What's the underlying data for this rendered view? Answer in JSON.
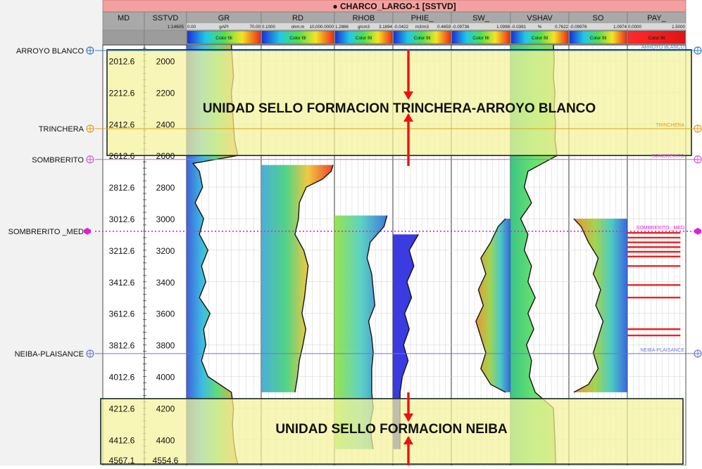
{
  "window": {
    "title": "● CHARCO_LARGO-1 [SSTVD]"
  },
  "colors": {
    "title_bar": "#f4a0a0",
    "header_bg": "#a9a9a9",
    "track_bg": "#ffffff",
    "yellow_zone": "#f4f39a",
    "zone_border": "#1a2a2a",
    "arrow": "#ee1111",
    "gr_fill_shallow": "#58c8a6",
    "gr_fill_deep": "#2f63d9",
    "curve": "#151515",
    "pay": "#ee2222"
  },
  "tracks": [
    {
      "name": "MD",
      "scale": "",
      "min": "",
      "unit": "",
      "max": "",
      "fill": ""
    },
    {
      "name": "SSTVD",
      "scale": "1:14605",
      "min": "",
      "unit": "",
      "max": "",
      "fill": ""
    },
    {
      "name": "GR",
      "scale": "",
      "min": "0.00",
      "unit": "gAPI",
      "max": "70.00",
      "fill": "Color fill"
    },
    {
      "name": "RD",
      "scale": "",
      "min": "0.1000",
      "unit": "ohm.m",
      "max": "10,000.0000",
      "fill": "Color fill"
    },
    {
      "name": "RHOB",
      "scale": "",
      "min": "1.2886",
      "unit": "g/cm3",
      "max": "3.1894",
      "fill": "Color fill"
    },
    {
      "name": "PHIE_",
      "scale": "",
      "min": "-0.0422",
      "unit": "m3/m3",
      "max": "0.4659",
      "fill": "Color fill"
    },
    {
      "name": "SW_",
      "scale": "",
      "min": "-0.09736",
      "unit": "",
      "max": "1.0998",
      "fill": "Color fill"
    },
    {
      "name": "VSHAV",
      "scale": "",
      "min": "-0.0391",
      "unit": "%",
      "max": "0.7622",
      "fill": "Color fill"
    },
    {
      "name": "SO",
      "scale": "",
      "min": "-0.09976",
      "unit": "",
      "max": "1.0974",
      "fill": "Color fill"
    },
    {
      "name": "PAY_",
      "scale": "",
      "min": "0.0000",
      "unit": "",
      "max": "1.5000",
      "fill": "Color fill"
    }
  ],
  "depths": {
    "md": [
      "2012.6",
      "2212.6",
      "2412.6",
      "2612.6",
      "2812.6",
      "3012.6",
      "3212.6",
      "3412.6",
      "3612.6",
      "3812.6",
      "4012.6",
      "4212.6",
      "4412.6",
      "4567.1"
    ],
    "sstvd": [
      "2000",
      "2200",
      "2400",
      "2600",
      "2800",
      "3000",
      "3200",
      "3400",
      "3600",
      "3800",
      "4000",
      "4200",
      "4400",
      "4554.6"
    ]
  },
  "formation_tops": [
    {
      "name": "ARROYO BLANCO",
      "right_label": "ARROYO BLANCO",
      "sstvd": 1935,
      "color": "#3b82c6",
      "style": "solid"
    },
    {
      "name": "TRINCHERA",
      "right_label": "TRINCHERA",
      "sstvd": 2430,
      "color": "#e0a020",
      "style": "solid"
    },
    {
      "name": "SOMBRERITO",
      "right_label": "SOMBRERITO",
      "sstvd": 2625,
      "color": "#d060d0",
      "style": "solid"
    },
    {
      "name": "SOMBRERITO _MED",
      "right_label": "SOMBRERITO _MED",
      "sstvd": 3080,
      "color": "#e020d0",
      "style": "dotted"
    },
    {
      "name": "NEIBA-PLAISANCE",
      "right_label": "NEIBA-PLAISANCE",
      "sstvd": 3855,
      "color": "#6a78d0",
      "style": "solid"
    }
  ],
  "zones": [
    {
      "label": "UNIDAD SELLO FORMACION TRINCHERA-ARROYO BLANCO",
      "top": 1930,
      "base": 2600
    },
    {
      "label": "UNIDAD SELLO FORMACION NEIBA",
      "top": 4140,
      "base": 4554.6
    }
  ],
  "chart_data": {
    "type": "line",
    "title": "CHARCO_LARGO-1 [SSTVD]",
    "y_axis": {
      "label": "SSTVD",
      "range": [
        1900,
        4554.6
      ],
      "inverted": true,
      "ticks": [
        2000,
        2200,
        2400,
        2600,
        2800,
        3000,
        3200,
        3400,
        3600,
        3800,
        4000,
        4200,
        4400,
        4554.6
      ]
    },
    "series": [
      {
        "name": "GR",
        "unit": "gAPI",
        "range": [
          0,
          70
        ],
        "depth": [
          1900,
          2000,
          2100,
          2200,
          2300,
          2400,
          2500,
          2600,
          2650,
          2700,
          2800,
          2900,
          3000,
          3100,
          3200,
          3300,
          3400,
          3500,
          3600,
          3700,
          3800,
          3900,
          4000,
          4100,
          4200,
          4300,
          4400,
          4500,
          4554.6
        ],
        "values": [
          42,
          43,
          44,
          42,
          43,
          44,
          45,
          48,
          6,
          12,
          15,
          8,
          16,
          12,
          20,
          14,
          18,
          12,
          22,
          16,
          18,
          14,
          20,
          42,
          44,
          43,
          44,
          46,
          48
        ]
      },
      {
        "name": "RD",
        "unit": "ohm.m",
        "range": [
          0.1,
          10000
        ],
        "depth": [
          2660,
          2700,
          2750,
          2800,
          2900,
          3000,
          3100,
          3200,
          3300,
          3400,
          3500,
          3600,
          3700,
          3800,
          3900,
          4000,
          4100
        ],
        "values": [
          8000,
          6000,
          1500,
          120,
          40,
          35,
          20,
          80,
          160,
          120,
          90,
          60,
          110,
          70,
          40,
          30,
          20
        ]
      },
      {
        "name": "RHOB",
        "unit": "g/cm3",
        "range": [
          1.2886,
          3.1894
        ],
        "depth": [
          2980,
          3050,
          3150,
          3250,
          3350,
          3450,
          3550,
          3650,
          3750,
          3850,
          3950,
          4100,
          4200,
          4300,
          4400,
          4460
        ],
        "values": [
          3.0,
          2.9,
          2.45,
          2.35,
          2.5,
          2.55,
          2.6,
          2.4,
          2.5,
          2.55,
          2.5,
          2.5,
          2.55,
          2.45,
          2.5,
          2.55
        ]
      },
      {
        "name": "PHIE_",
        "unit": "m3/m3",
        "range": [
          -0.0422,
          0.4659
        ],
        "depth": [
          3100,
          3200,
          3300,
          3400,
          3500,
          3600,
          3700,
          3800,
          3900,
          4000,
          4100,
          4200,
          4300,
          4400,
          4460
        ],
        "values": [
          0.18,
          0.1,
          0.14,
          0.08,
          0.12,
          0.06,
          0.1,
          0.05,
          0.09,
          0.04,
          0.02,
          0.02,
          0.02,
          0.02,
          0.02
        ]
      },
      {
        "name": "SW_",
        "unit": "",
        "range": [
          -0.09736,
          1.0998
        ],
        "depth": [
          3000,
          3050,
          3150,
          3250,
          3350,
          3450,
          3550,
          3650,
          3750,
          3850,
          3950,
          4050,
          4100
        ],
        "values": [
          1.0,
          0.85,
          0.7,
          0.5,
          0.6,
          0.45,
          0.55,
          0.4,
          0.5,
          0.6,
          0.5,
          0.7,
          1.0
        ]
      },
      {
        "name": "VSHAV",
        "unit": "%",
        "range": [
          -0.0391,
          0.7622
        ],
        "depth": [
          1900,
          2000,
          2100,
          2200,
          2300,
          2400,
          2500,
          2600,
          2700,
          2800,
          2900,
          3000,
          3100,
          3200,
          3300,
          3400,
          3500,
          3600,
          3700,
          3800,
          3900,
          4000,
          4100,
          4200,
          4300,
          4400,
          4554.6
        ],
        "values": [
          0.55,
          0.56,
          0.55,
          0.57,
          0.56,
          0.58,
          0.57,
          0.6,
          0.2,
          0.15,
          0.25,
          0.1,
          0.2,
          0.15,
          0.25,
          0.2,
          0.3,
          0.2,
          0.28,
          0.18,
          0.25,
          0.22,
          0.3,
          0.55,
          0.56,
          0.57,
          0.58
        ]
      },
      {
        "name": "SO",
        "unit": "",
        "range": [
          -0.09976,
          1.0974
        ],
        "depth": [
          3000,
          3050,
          3150,
          3250,
          3350,
          3450,
          3550,
          3650,
          3750,
          3850,
          3950,
          4050,
          4100
        ],
        "values": [
          0.0,
          0.15,
          0.3,
          0.5,
          0.4,
          0.55,
          0.45,
          0.6,
          0.5,
          0.4,
          0.5,
          0.3,
          0.0
        ]
      },
      {
        "name": "PAY_",
        "unit": "",
        "range": [
          0,
          1.5
        ],
        "depth": [
          3090,
          3120,
          3150,
          3180,
          3210,
          3240,
          3300,
          3420,
          3500,
          3700,
          3740
        ],
        "values": [
          1,
          1,
          1,
          1,
          1,
          1,
          1,
          1,
          1,
          1,
          1
        ]
      }
    ]
  }
}
